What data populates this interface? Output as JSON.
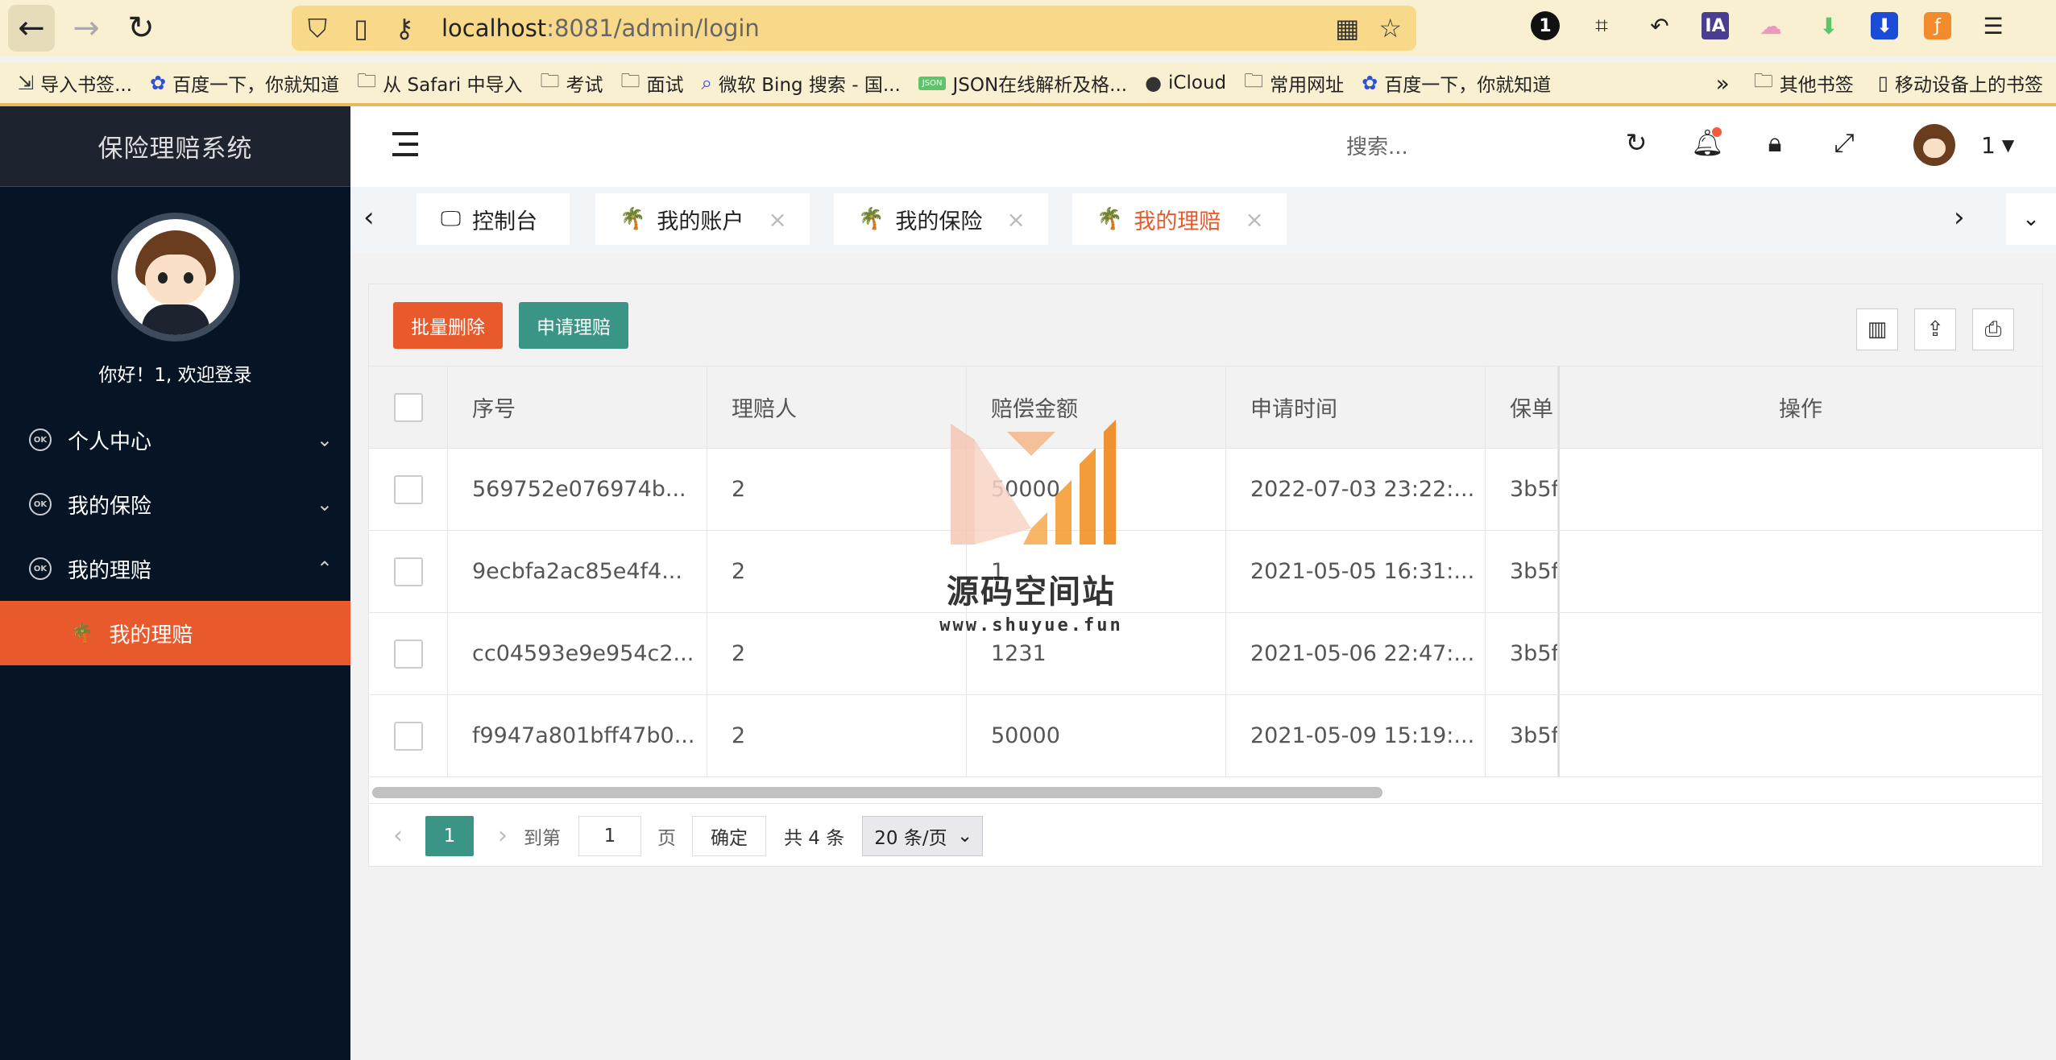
{
  "browser": {
    "url_host": "localhost",
    "url_rest": ":8081/admin/login",
    "bookmarks": [
      "导入书签...",
      "百度一下，你就知道",
      "从 Safari 中导入",
      "考试",
      "面试",
      "微软 Bing 搜索 - 国...",
      "JSON在线解析及格...",
      "iCloud",
      "常用网址",
      "百度一下，你就知道"
    ],
    "bookmarks_right": [
      "其他书签",
      "移动设备上的书签"
    ],
    "ext_badge": "1",
    "ext_ia": "IA"
  },
  "sidebar": {
    "title": "保险理赔系统",
    "greeting": "你好！1, 欢迎登录",
    "menu": [
      {
        "label": "个人中心",
        "caret": "⌄"
      },
      {
        "label": "我的保险",
        "caret": "⌄"
      },
      {
        "label": "我的理赔",
        "caret": "⌃"
      }
    ],
    "submenu_active": "我的理赔"
  },
  "header": {
    "search_placeholder": "搜索...",
    "username": "1"
  },
  "tabs": [
    {
      "label": "控制台",
      "closable": false
    },
    {
      "label": "我的账户",
      "closable": true
    },
    {
      "label": "我的保险",
      "closable": true
    },
    {
      "label": "我的理赔",
      "closable": true,
      "active": true
    }
  ],
  "toolbar": {
    "batch_delete": "批量删除",
    "apply_claim": "申请理赔"
  },
  "table": {
    "columns": [
      "序号",
      "理赔人",
      "赔偿金额",
      "申请时间",
      "保单",
      "操作"
    ],
    "rows": [
      {
        "id": "569752e076974b...",
        "claimant": "2",
        "amount": "50000",
        "time": "2022-07-03 23:22:...",
        "policy": "3b5f"
      },
      {
        "id": "9ecbfa2ac85e4f4...",
        "claimant": "2",
        "amount": "1",
        "time": "2021-05-05 16:31:...",
        "policy": "3b5f"
      },
      {
        "id": "cc04593e9e954c2...",
        "claimant": "2",
        "amount": "1231",
        "time": "2021-05-06 22:47:...",
        "policy": "3b5f"
      },
      {
        "id": "f9947a801bff47b0...",
        "claimant": "2",
        "amount": "50000",
        "time": "2021-05-09 15:19:...",
        "policy": "3b5f"
      }
    ]
  },
  "pager": {
    "current": "1",
    "goto_label": "到第",
    "goto_value": "1",
    "page_unit": "页",
    "confirm": "确定",
    "total": "共 4 条",
    "page_size": "20 条/页"
  },
  "watermark": {
    "title": "源码空间站",
    "url": "www.shuyue.fun"
  },
  "colors": {
    "accent_orange": "#e8592b",
    "accent_teal": "#3b9587",
    "sidebar_bg": "#061426"
  }
}
